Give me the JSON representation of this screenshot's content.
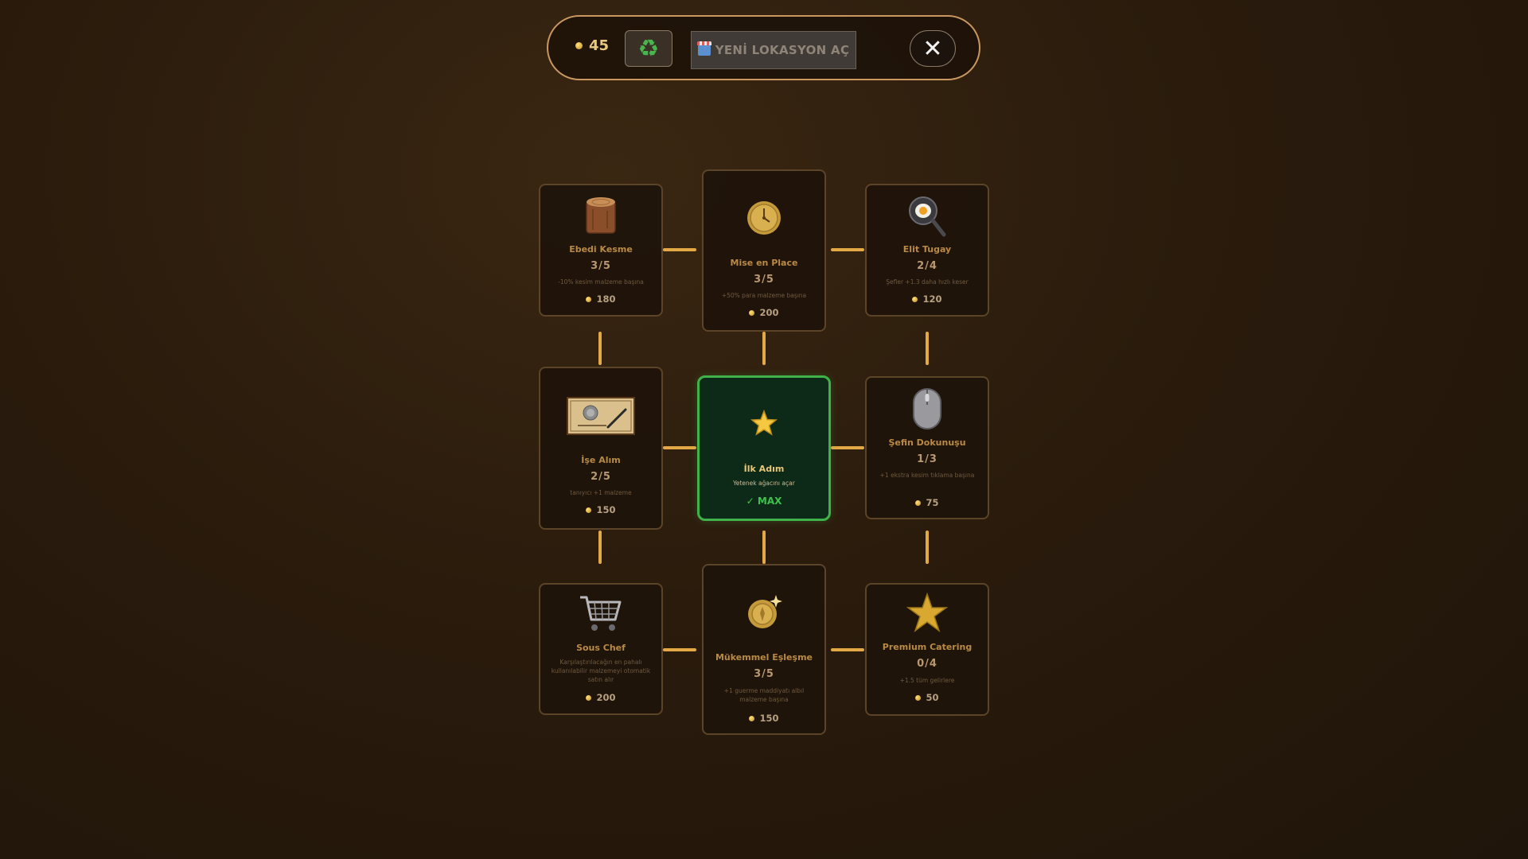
{
  "topbar": {
    "coins": "45",
    "recycle_icon": "♻",
    "new_location_label": "YENİ LOKASYON AÇ",
    "close_icon": "✕"
  },
  "skills": {
    "ebedi_kesme": {
      "name": "Ebedi Kesme",
      "level": "3/5",
      "desc": "-10% kesim malzeme başına",
      "cost": "180"
    },
    "mise_en_place": {
      "name": "Mise en Place",
      "level": "3/5",
      "desc": "+50% para malzeme başına",
      "cost": "200"
    },
    "elit_tugay": {
      "name": "Elit Tugay",
      "level": "2/4",
      "desc": "Şefler +1.3 daha hızlı keser",
      "cost": "120"
    },
    "ise_alim": {
      "name": "İşe Alım",
      "level": "2/5",
      "desc": "tanıyıcı +1 malzeme",
      "cost": "150"
    },
    "ilk_adim": {
      "name": "İlk Adım",
      "desc": "Yetenek ağacını açar",
      "max": "✓ MAX"
    },
    "sefin_dokunusu": {
      "name": "Şefin Dokunuşu",
      "level": "1/3",
      "desc": "+1 ekstra kesim tıklama başına",
      "cost": "75"
    },
    "sous_chef": {
      "name": "Sous Chef",
      "desc": "Karşılaştırılacağın en pahalı kullanılabilir malzemeyi otomatik satın alır",
      "cost": "200"
    },
    "mukemmel_eslesme": {
      "name": "Mükemmel Eşleşme",
      "level": "3/5",
      "desc": "+1 guerme maddiyatı albıl malzeme başına",
      "cost": "150"
    },
    "premium_catering": {
      "name": "Premium Catering",
      "level": "0/4",
      "desc": "+1.5 tüm gelirlere",
      "cost": "50"
    }
  }
}
